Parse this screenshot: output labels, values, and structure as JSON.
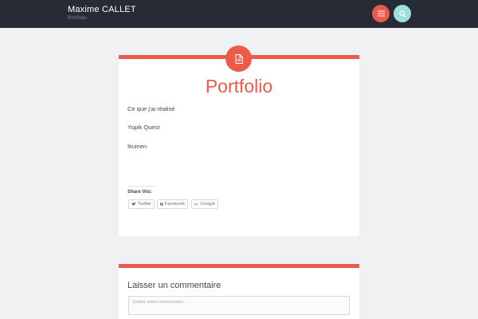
{
  "site": {
    "title": "Maxime CALLET",
    "description": "Portfolio"
  },
  "header_buttons": {
    "menu_icon": "hamburger-menu-icon",
    "search_icon": "search-icon",
    "menu_color": "#ec5a4a",
    "search_color": "#9fe0dc"
  },
  "page": {
    "icon": "document-icon",
    "title": "Portfolio",
    "links": [
      "Ce que j'ai réalisé",
      "Yupik Quest",
      "Ikuinen"
    ]
  },
  "share": {
    "title": "Share this:",
    "buttons": [
      {
        "label": "Twitter",
        "icon": "twitter-icon"
      },
      {
        "label": "Facebook",
        "icon": "facebook-icon"
      },
      {
        "label": "Google",
        "icon": "google-plus-icon"
      }
    ]
  },
  "comments": {
    "title": "Laisser un commentaire",
    "placeholder": "Entrez votre commentaire..."
  },
  "colors": {
    "accent": "#ec5a4a",
    "header_bg": "#262b36",
    "page_bg": "#f0f1f3"
  }
}
